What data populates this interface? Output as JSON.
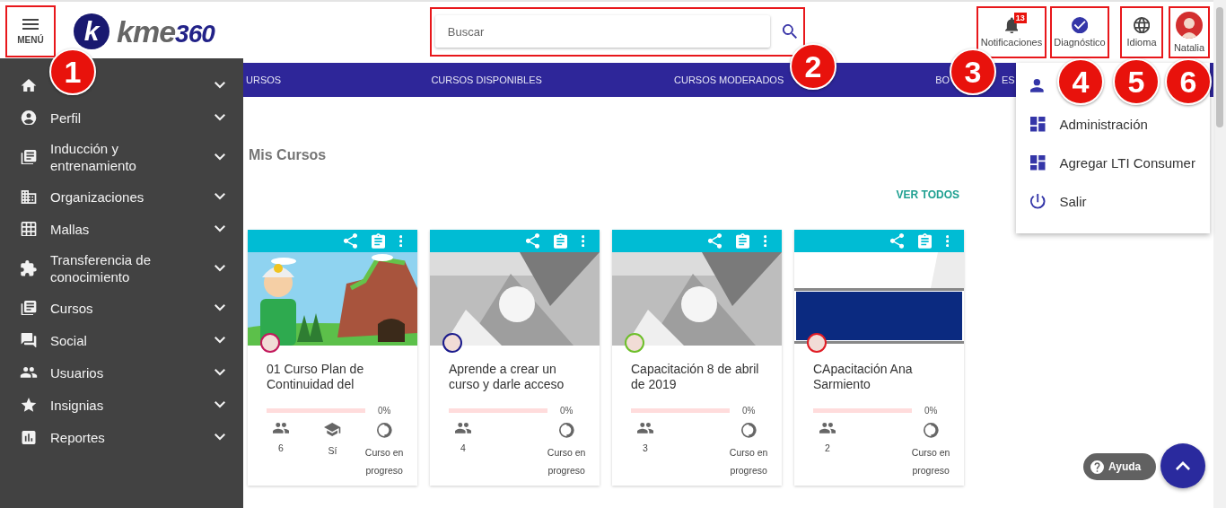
{
  "header": {
    "menu_button": {
      "label": "MENÚ",
      "highlighted": true
    },
    "logo": {
      "mark": "k",
      "text": "kme",
      "suffix": "360"
    },
    "search": {
      "placeholder": "Buscar",
      "highlighted": true
    },
    "actions": [
      {
        "kind": "notifications",
        "label": "Notificaciones",
        "badge": "13",
        "highlighted": true
      },
      {
        "kind": "diagnostic",
        "label": "Diagnóstico",
        "highlighted": true
      },
      {
        "kind": "language",
        "label": "Idioma",
        "highlighted": true
      },
      {
        "kind": "user",
        "label": "Natalia",
        "highlighted": true
      }
    ]
  },
  "callouts": [
    "1",
    "2",
    "3",
    "4",
    "5",
    "6"
  ],
  "nav": {
    "tabs": [
      {
        "label": "URSOS"
      },
      {
        "label": "CURSOS DISPONIBLES"
      },
      {
        "label": "CURSOS MODERADOS"
      },
      {
        "label": "BO",
        "label_end": "ES"
      }
    ]
  },
  "sidebar": {
    "items": [
      {
        "kind": "home"
      },
      {
        "kind": "account",
        "label": "Perfil"
      },
      {
        "kind": "library",
        "label": "Inducción y entrenamiento"
      },
      {
        "kind": "domain",
        "label": "Organizaciones"
      },
      {
        "kind": "grid",
        "label": "Mallas"
      },
      {
        "kind": "puzzle",
        "label": "Transferencia de conocimiento"
      },
      {
        "kind": "library",
        "label": "Cursos"
      },
      {
        "kind": "forum",
        "label": "Social"
      },
      {
        "kind": "people",
        "label": "Usuarios"
      },
      {
        "kind": "star",
        "label": "Insignias"
      },
      {
        "kind": "chart",
        "label": "Reportes"
      }
    ]
  },
  "user_menu": {
    "items": [
      {
        "kind": "person"
      },
      {
        "kind": "dashboard",
        "label": "Administración"
      },
      {
        "kind": "dashboard",
        "label": "Agregar LTI Consumer"
      },
      {
        "kind": "power",
        "label": "Salir"
      }
    ]
  },
  "courses": {
    "title": "Mis Cursos",
    "view_all": "VER TODOS",
    "cards": [
      {
        "avatar": {
          "color": "#c2185b"
        },
        "title": "01 Curso Plan de Continuidad del",
        "level": 0,
        "percent": "0%",
        "stats": [
          {
            "kind": "people",
            "text": "6"
          },
          {
            "kind": "school",
            "text": "Sí"
          },
          {
            "kind": "progress",
            "text": "Curso en progreso"
          }
        ]
      },
      {
        "avatar": {
          "color": "#1a1a8c"
        },
        "title": "Aprende a crear un curso y darle acceso",
        "level": 0,
        "percent": "0%",
        "stats": [
          {
            "kind": "people",
            "text": "4"
          },
          {
            "kind": "progress",
            "text": "Curso en progreso"
          }
        ]
      },
      {
        "avatar": {
          "color": "#6dbf2a"
        },
        "title": "Capacitación 8 de abril de 2019",
        "level": 0,
        "percent": "0%",
        "stats": [
          {
            "kind": "people",
            "text": "3"
          },
          {
            "kind": "progress",
            "text": "Curso en progreso"
          }
        ]
      },
      {
        "avatar": {
          "color": "#e01b24"
        },
        "title": "CApacitación Ana Sarmiento",
        "level": 0,
        "percent": "0%",
        "stats": [
          {
            "kind": "people",
            "text": "2"
          },
          {
            "kind": "progress",
            "text": "Curso en progreso"
          }
        ]
      }
    ]
  },
  "help": {
    "label": "Ayuda"
  }
}
